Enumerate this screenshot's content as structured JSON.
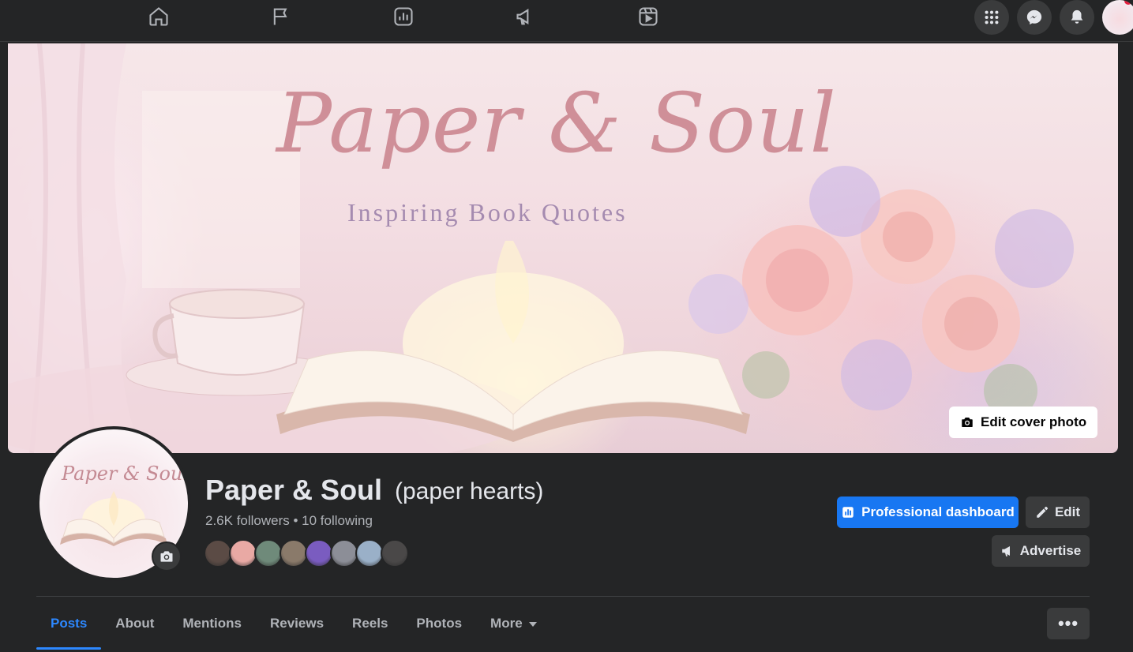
{
  "topbar": {
    "nav_icons": [
      "home-icon",
      "flag-icon",
      "insights-icon",
      "megaphone-icon",
      "reels-icon"
    ],
    "right_icons": [
      "menu-grid-icon",
      "messenger-icon",
      "bell-icon"
    ]
  },
  "cover": {
    "title": "Paper & Soul",
    "subtitle": "Inspiring Book Quotes",
    "edit_label": "Edit cover photo"
  },
  "profile": {
    "avatar_title": "Paper & Soul",
    "name": "Paper & Soul",
    "alt_name": "(paper hearts)",
    "stats": "2.6K followers • 10 following",
    "followers": "2.6K",
    "following": "10",
    "friend_colors": [
      "#5b4b45",
      "#e9a9a4",
      "#6f8a7a",
      "#8a7a6a",
      "#7a5cc0",
      "#8c8e97",
      "#9ab0c8",
      "#4a4848"
    ]
  },
  "actions": {
    "professional_dashboard": "Professional dashboard",
    "edit": "Edit",
    "advertise": "Advertise"
  },
  "tabs": {
    "posts": "Posts",
    "about": "About",
    "mentions": "Mentions",
    "reviews": "Reviews",
    "reels": "Reels",
    "photos": "Photos",
    "more": "More",
    "overflow": "•••"
  },
  "colors": {
    "accent": "#1877f2",
    "active_tab": "#2d88ff",
    "background": "#242526"
  }
}
